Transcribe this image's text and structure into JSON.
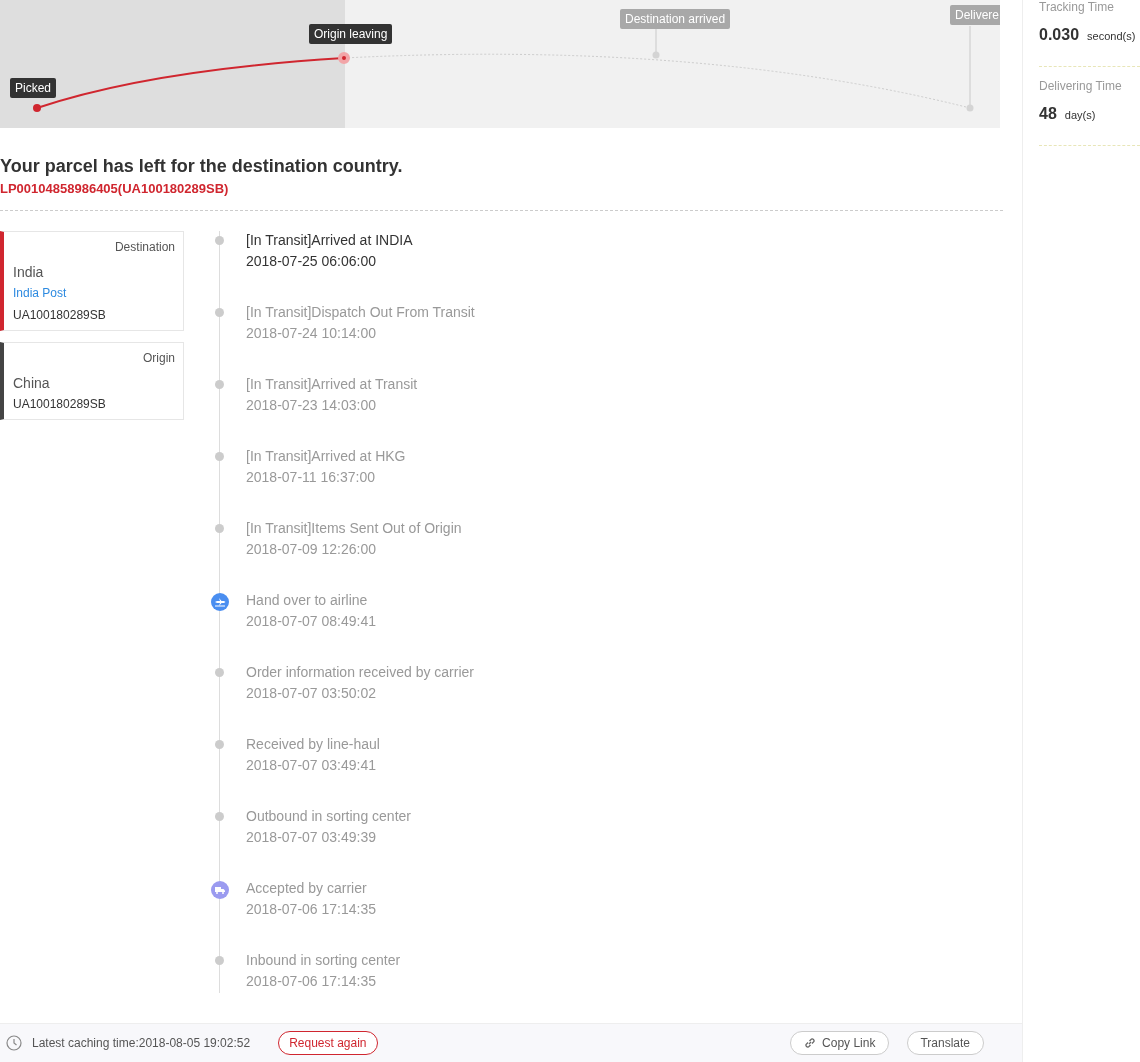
{
  "map": {
    "milestones": [
      {
        "label": "Picked",
        "reached": true
      },
      {
        "label": "Origin leaving",
        "reached": true
      },
      {
        "label": "Destination arrived",
        "reached": false
      },
      {
        "label": "Delivere",
        "reached": false
      }
    ]
  },
  "status": {
    "title": "Your parcel has left for the destination country.",
    "number": "LP00104858986405(UA100180289SB)"
  },
  "cards": [
    {
      "kind": "destination",
      "heading": "Destination",
      "country": "India",
      "carrier": "India Post",
      "number": "UA100180289SB"
    },
    {
      "kind": "origin",
      "heading": "Origin",
      "country": "China",
      "number": "UA100180289SB"
    }
  ],
  "events": [
    {
      "kind": "dot",
      "current": true,
      "text": "[In Transit]Arrived at INDIA",
      "time": "2018-07-25 06:06:00"
    },
    {
      "kind": "dot",
      "current": false,
      "text": "[In Transit]Dispatch Out From Transit",
      "time": "2018-07-24 10:14:00"
    },
    {
      "kind": "dot",
      "current": false,
      "text": "[In Transit]Arrived at Transit",
      "time": "2018-07-23 14:03:00"
    },
    {
      "kind": "dot",
      "current": false,
      "text": "[In Transit]Arrived at HKG",
      "time": "2018-07-11 16:37:00"
    },
    {
      "kind": "dot",
      "current": false,
      "text": "[In Transit]Items Sent Out of Origin",
      "time": "2018-07-09 12:26:00"
    },
    {
      "kind": "plane",
      "current": false,
      "text": "Hand over to airline",
      "time": "2018-07-07 08:49:41"
    },
    {
      "kind": "dot",
      "current": false,
      "text": "Order information received by carrier",
      "time": "2018-07-07 03:50:02"
    },
    {
      "kind": "dot",
      "current": false,
      "text": "Received by line-haul",
      "time": "2018-07-07 03:49:41"
    },
    {
      "kind": "dot",
      "current": false,
      "text": "Outbound in sorting center",
      "time": "2018-07-07 03:49:39"
    },
    {
      "kind": "truck",
      "current": false,
      "text": "Accepted by carrier",
      "time": "2018-07-06 17:14:35"
    },
    {
      "kind": "dot",
      "current": false,
      "text": "Inbound in sorting center",
      "time": "2018-07-06 17:14:35"
    }
  ],
  "footer": {
    "caching": "Latest caching time:2018-08-05 19:02:52",
    "request_button": "Request again",
    "copy_button": "Copy Link",
    "translate_button": "Translate"
  },
  "stats": [
    {
      "label": "Tracking Time",
      "value": "0.030",
      "unit": "second(s)"
    },
    {
      "label": "Delivering Time",
      "value": "48",
      "unit": "day(s)"
    }
  ]
}
